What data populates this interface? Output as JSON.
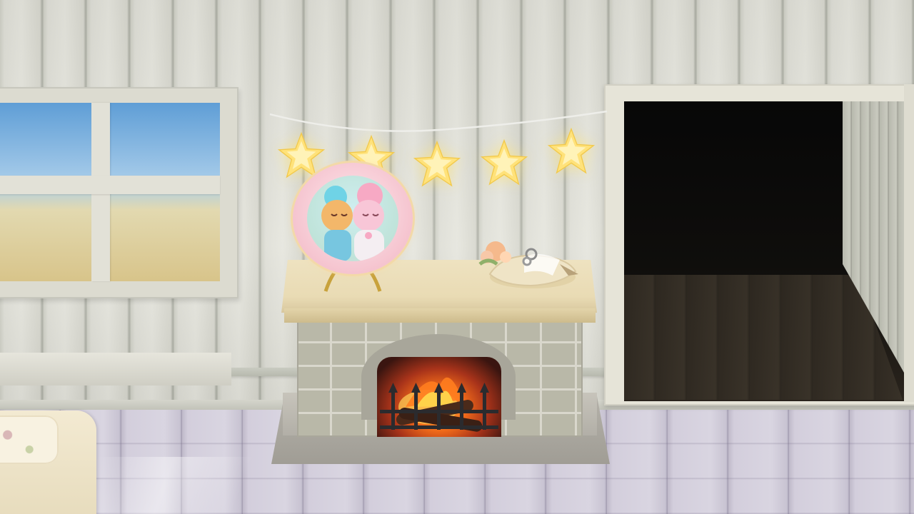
{
  "scene": {
    "type": "room-interior",
    "objects": [
      "wood-panel-wall",
      "window",
      "doorway",
      "star-light-garland",
      "brick-fireplace",
      "commemorative-plate",
      "ring-pillow",
      "bed-corner"
    ]
  },
  "garland": {
    "star_count": 5,
    "star_color": "#ffe27a",
    "glow_color": "#fff1a8"
  },
  "fireplace": {
    "fire_lit": true,
    "fire_colors": [
      "#ffb640",
      "#f06a1a",
      "#a8331a"
    ]
  },
  "colors": {
    "wall": "#dfdfd7",
    "floor": "#d3cedc",
    "mantel": "#e9dbb4",
    "brick": "#b9b8a8",
    "sky": "#5f9ed6",
    "doorway_dark": "#070707"
  }
}
